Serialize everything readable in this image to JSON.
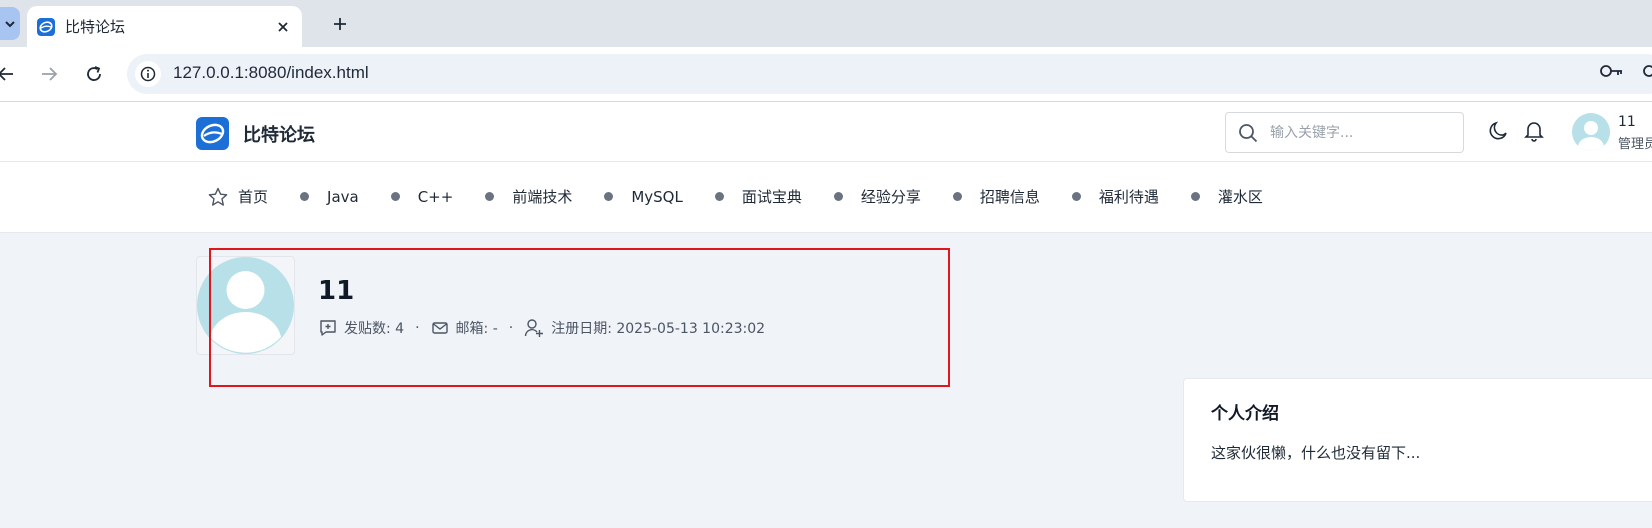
{
  "browser": {
    "tab_title": "比特论坛",
    "url": "127.0.0.1:8080/index.html"
  },
  "header": {
    "brand": "比特论坛",
    "search_placeholder": "输入关键字...",
    "user_name": "11",
    "user_role": "管理员"
  },
  "nav": {
    "items": [
      "首页",
      "Java",
      "C++",
      "前端技术",
      "MySQL",
      "面试宝典",
      "经验分享",
      "招聘信息",
      "福利待遇",
      "灌水区"
    ]
  },
  "profile": {
    "name": "11",
    "posts_label": "发贴数: 4",
    "email_label": "邮箱: -",
    "register_label": "注册日期: 2025-05-13 10:23:02",
    "separator": "·"
  },
  "intro": {
    "title": "个人介绍",
    "text": "这家伙很懒，什么也没有留下..."
  },
  "colors": {
    "brand_blue": "#1d6fd8",
    "avatar_bg": "#b7e0e8",
    "highlight": "#e0161c"
  }
}
